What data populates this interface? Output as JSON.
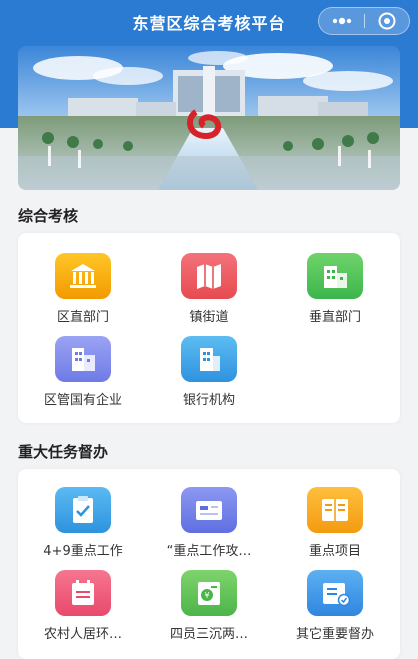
{
  "app": {
    "title": "东营区综合考核平台"
  },
  "capsule": {
    "more_icon": "more-dots-icon",
    "close_icon": "target-close-icon"
  },
  "banner": {
    "icon": "city-square-photo"
  },
  "section_comprehensive": {
    "title": "综合考核",
    "items": [
      {
        "label": "区直部门",
        "icon": "building-columns-icon",
        "color": "#f5b000"
      },
      {
        "label": "镇街道",
        "icon": "map-icon",
        "color": "#ee5b5e"
      },
      {
        "label": "垂直部门",
        "icon": "office-buildings-icon",
        "color": "#4cc35a"
      },
      {
        "label": "区管国有企业",
        "icon": "enterprise-buildings-icon",
        "color": "#7b86ea"
      },
      {
        "label": "银行机构",
        "icon": "bank-building-icon",
        "color": "#3aa3e6"
      }
    ]
  },
  "section_supervision": {
    "title": "重大任务督办",
    "items": [
      {
        "label": "4+9重点工作",
        "icon": "checklist-icon",
        "color": "#3aa3e6"
      },
      {
        "label": "“重点工作攻…",
        "icon": "id-card-icon",
        "color": "#6f7fe8"
      },
      {
        "label": "重点项目",
        "icon": "open-book-icon",
        "color": "#f5a623"
      },
      {
        "label": "农村人居环…",
        "icon": "calendar-list-icon",
        "color": "#f05c7a"
      },
      {
        "label": "四员三沉两…",
        "icon": "money-doc-icon",
        "color": "#5cc05a"
      },
      {
        "label": "其它重要督办",
        "icon": "folder-check-icon",
        "color": "#3a93e3"
      }
    ]
  }
}
